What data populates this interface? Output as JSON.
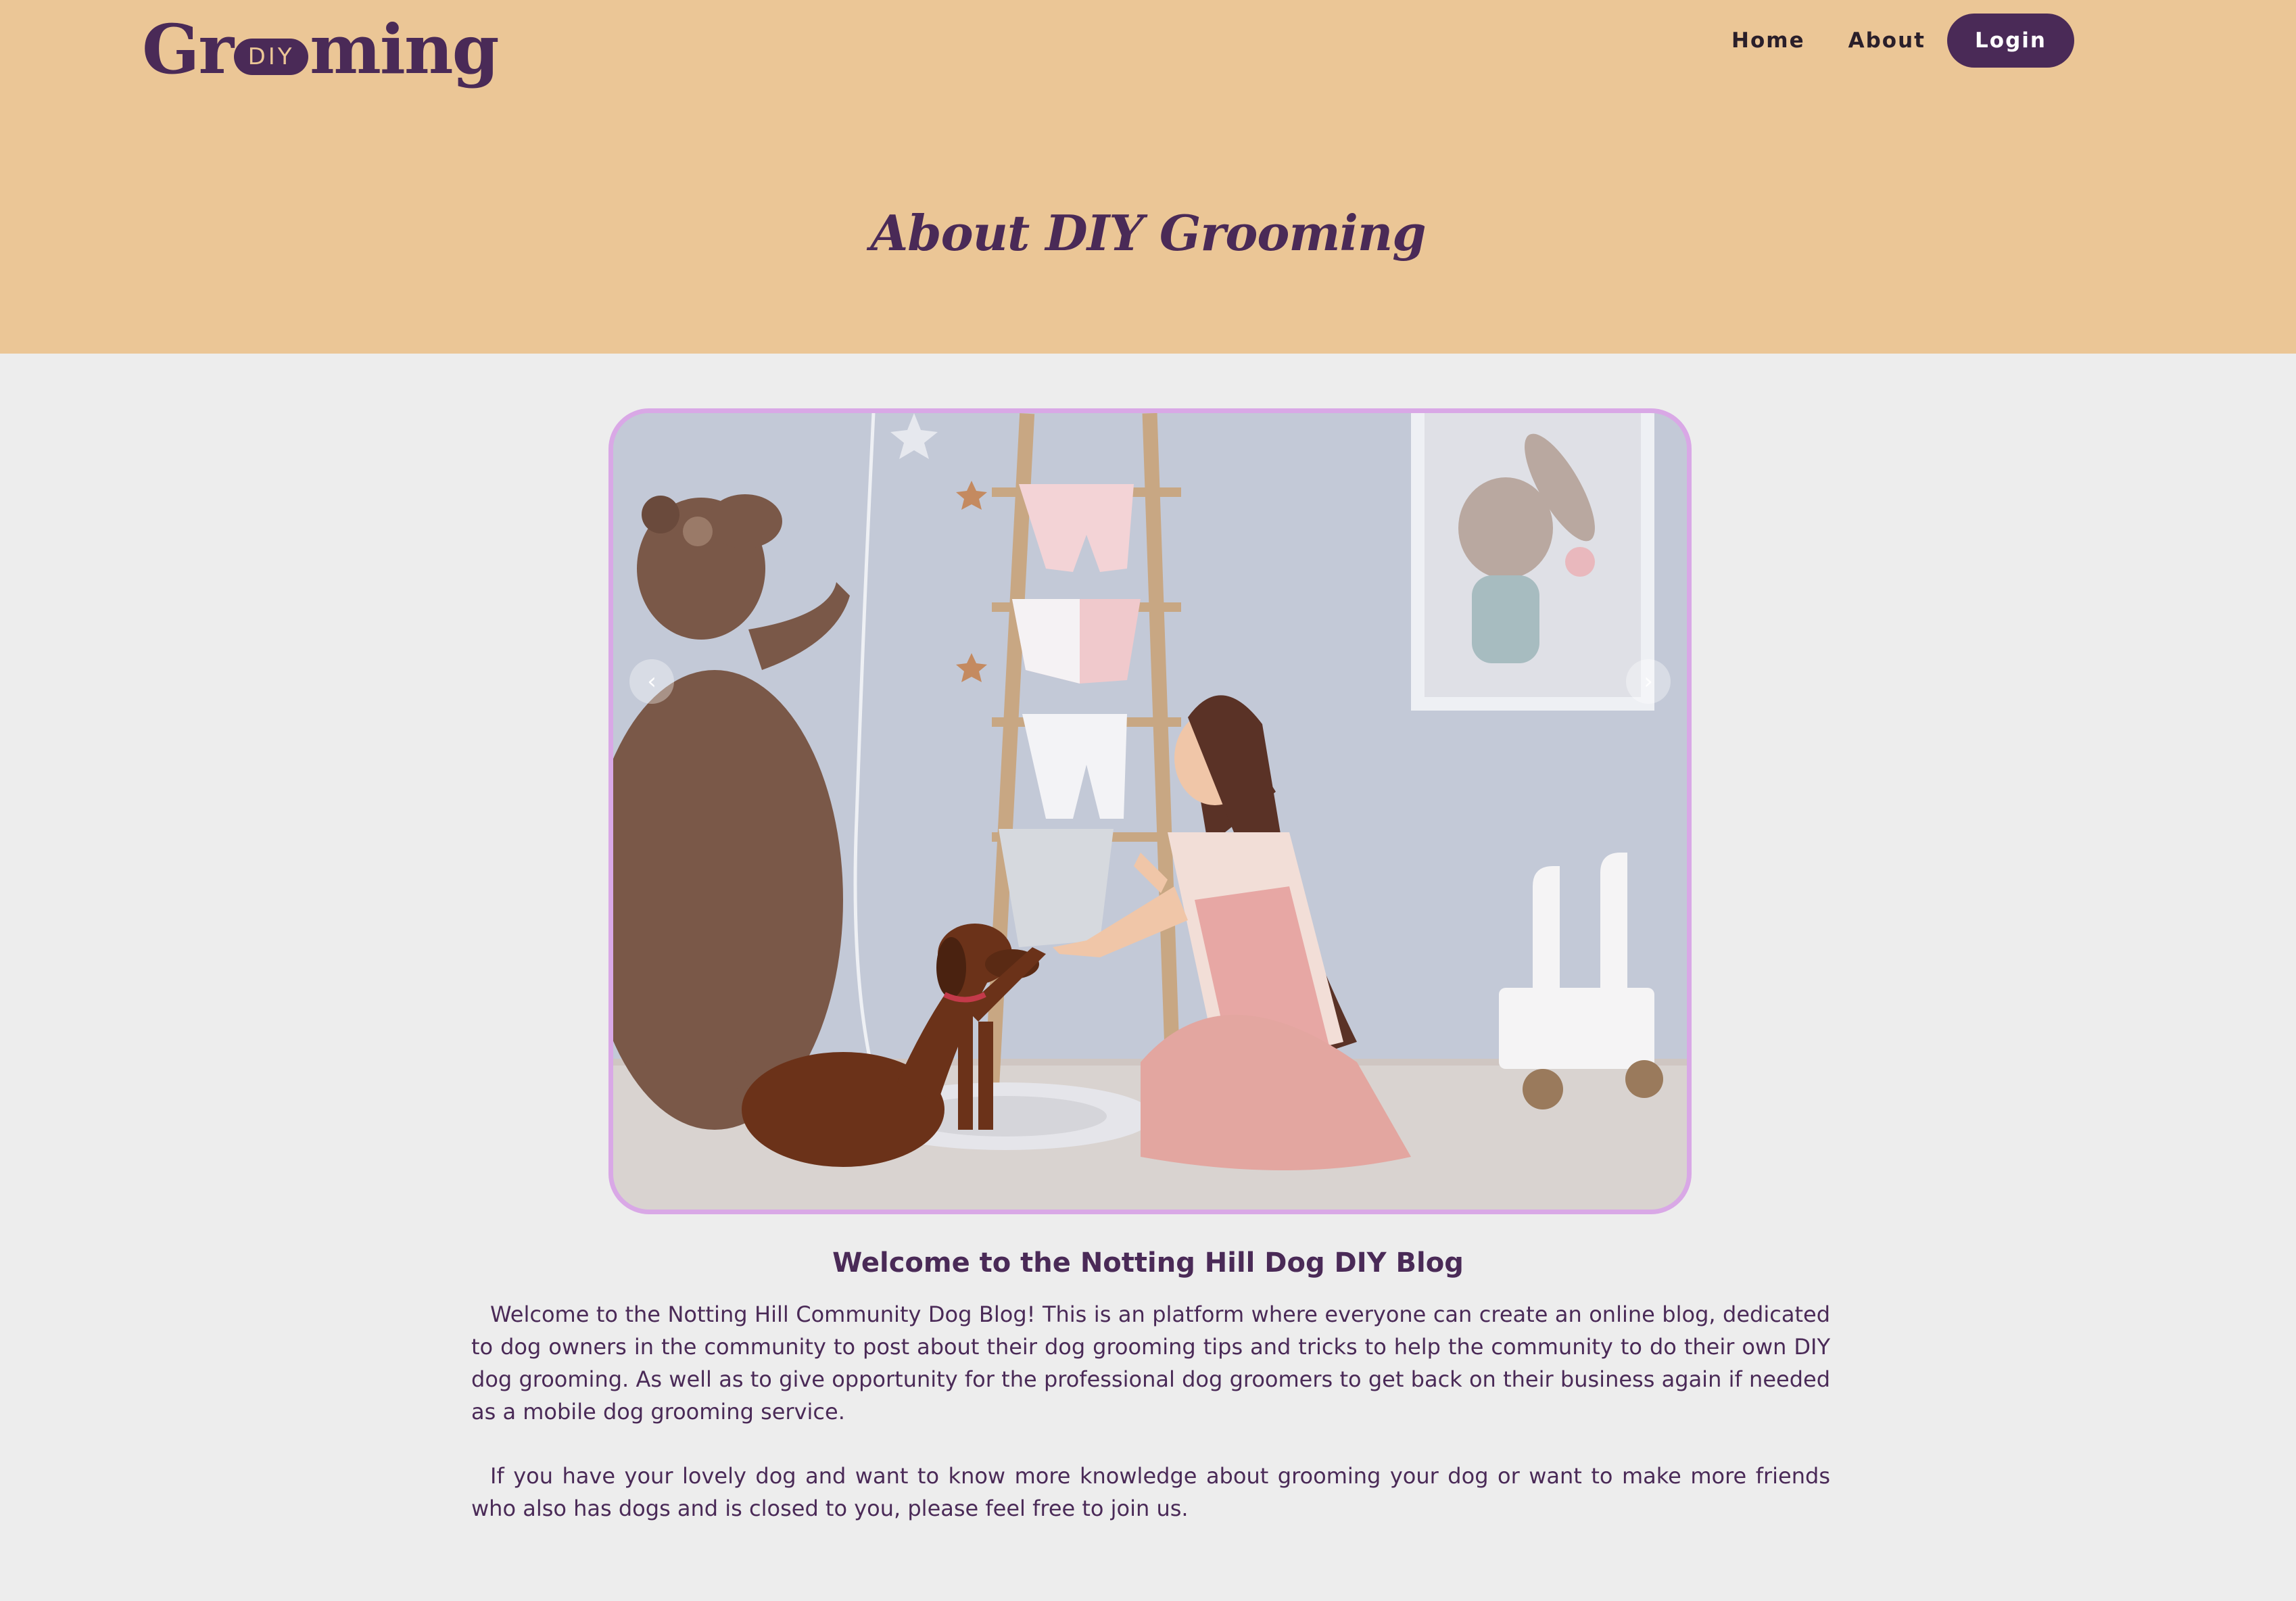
{
  "brand": {
    "logo_left": "Gr",
    "logo_badge": "DIY",
    "logo_right": "ming"
  },
  "nav": {
    "items": [
      {
        "label": "Home"
      },
      {
        "label": "About"
      }
    ],
    "login_label": "Login"
  },
  "page": {
    "title": "About DIY Grooming"
  },
  "carousel": {
    "prev_icon": "‹",
    "next_icon": "›",
    "image_alt": "Woman high-fiving a dachshund in a nursery room"
  },
  "blog": {
    "heading": "Welcome to the Notting Hill Dog DIY Blog",
    "paragraphs": [
      "Welcome to the Notting Hill Community Dog Blog! This is an platform where everyone can create an online blog, dedicated to dog owners in the community to post about their dog grooming tips and tricks to help the community to do their own DIY dog grooming. As well as to give opportunity for the professional dog groomers to get back on their business again if needed as a mobile dog grooming service.",
      "If you have your lovely dog and want to know more knowledge about grooming your dog or want to make more friends who also has dogs and is closed to you, please feel free to join us."
    ]
  },
  "colors": {
    "header_bg": "#ebc696",
    "brand_purple": "#4a2a57",
    "page_bg": "#ededed",
    "carousel_border": "#d9a8e6"
  }
}
